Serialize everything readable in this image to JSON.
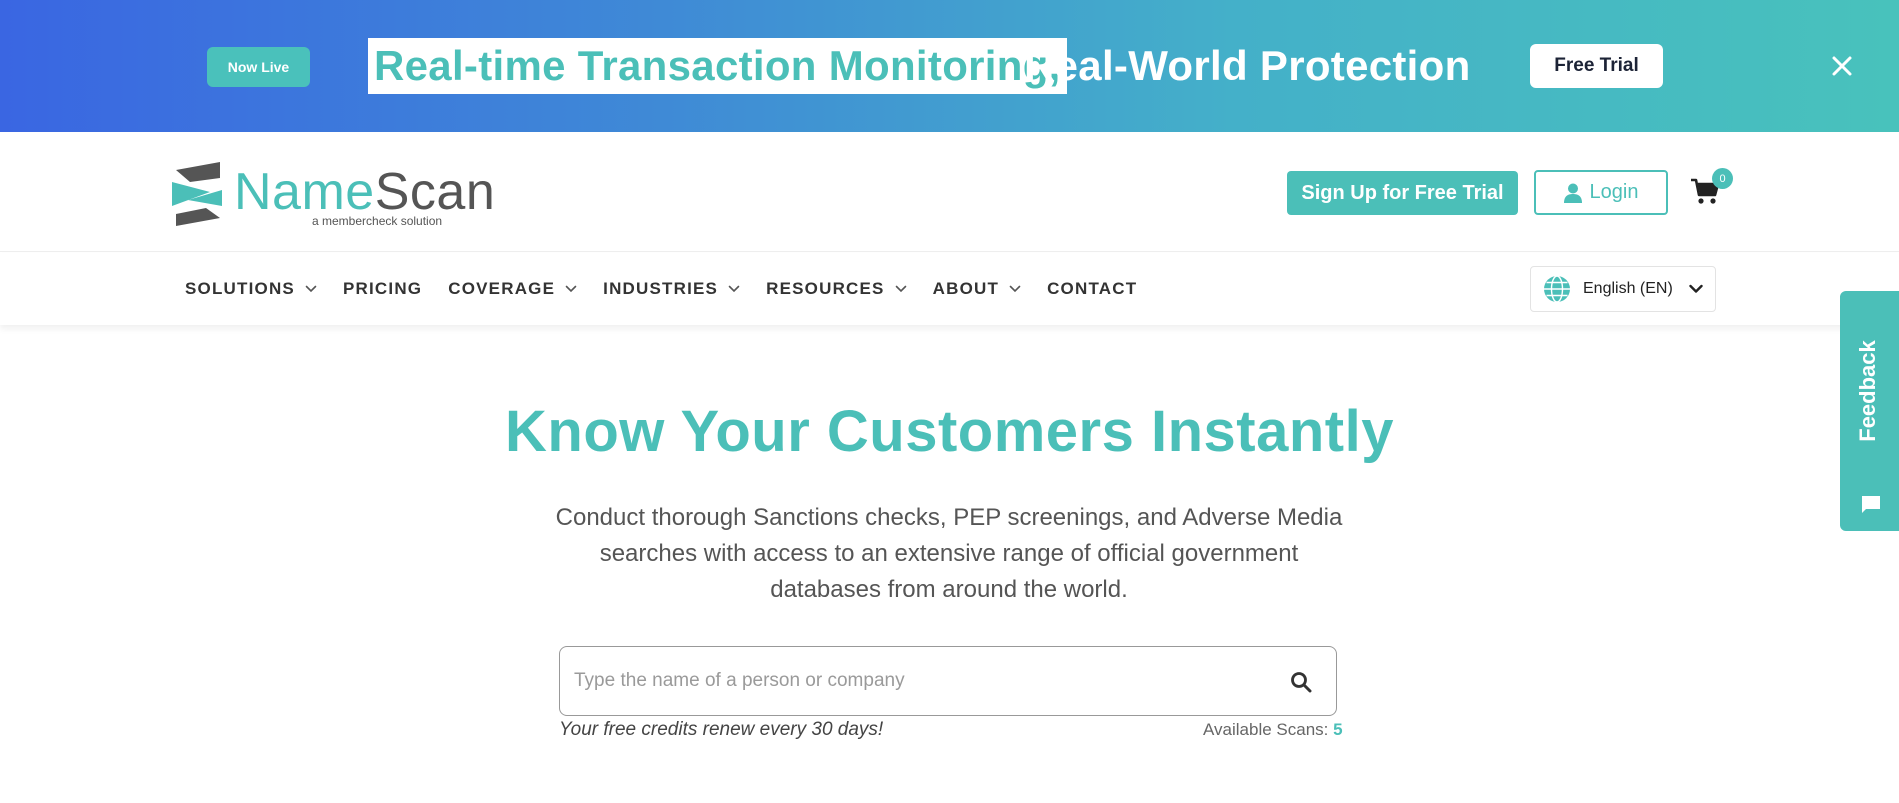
{
  "banner": {
    "badge": "Now Live",
    "headline_highlight": "Real-time Transaction Monitoring,",
    "headline_rest": "Real-World Protection",
    "cta": "Free Trial"
  },
  "header": {
    "logo_name_a": "Name",
    "logo_name_b": "Scan",
    "logo_tagline": "a membercheck solution",
    "signup_label": "Sign Up for Free Trial",
    "login_label": "Login",
    "cart_count": "0"
  },
  "nav": {
    "items": [
      {
        "label": "SOLUTIONS",
        "has_dropdown": true
      },
      {
        "label": "PRICING",
        "has_dropdown": false
      },
      {
        "label": "COVERAGE",
        "has_dropdown": true
      },
      {
        "label": "INDUSTRIES",
        "has_dropdown": true
      },
      {
        "label": "RESOURCES",
        "has_dropdown": true
      },
      {
        "label": "ABOUT",
        "has_dropdown": true
      },
      {
        "label": "CONTACT",
        "has_dropdown": false
      }
    ],
    "language": "English (EN)"
  },
  "hero": {
    "title": "Know Your Customers Instantly",
    "description": "Conduct thorough Sanctions checks, PEP screenings, and Adverse Media searches with access to an extensive range of official government databases from around the world.",
    "search_placeholder": "Type the name of a person or company",
    "search_value": "",
    "credits_note": "Your free credits renew every 30 days!",
    "available_label": "Available Scans:",
    "available_count": "5"
  },
  "feedback": {
    "label": "Feedback"
  },
  "icons": {
    "close": "close-icon",
    "search": "search-icon",
    "cart": "cart-icon",
    "user": "user-icon",
    "globe": "globe-icon",
    "chat": "chat-icon"
  },
  "colors": {
    "brand_teal": "#4bbfb8",
    "banner_gradient_start": "#3a66e2",
    "banner_gradient_end": "#48c2bc",
    "text_dark": "#333333"
  }
}
